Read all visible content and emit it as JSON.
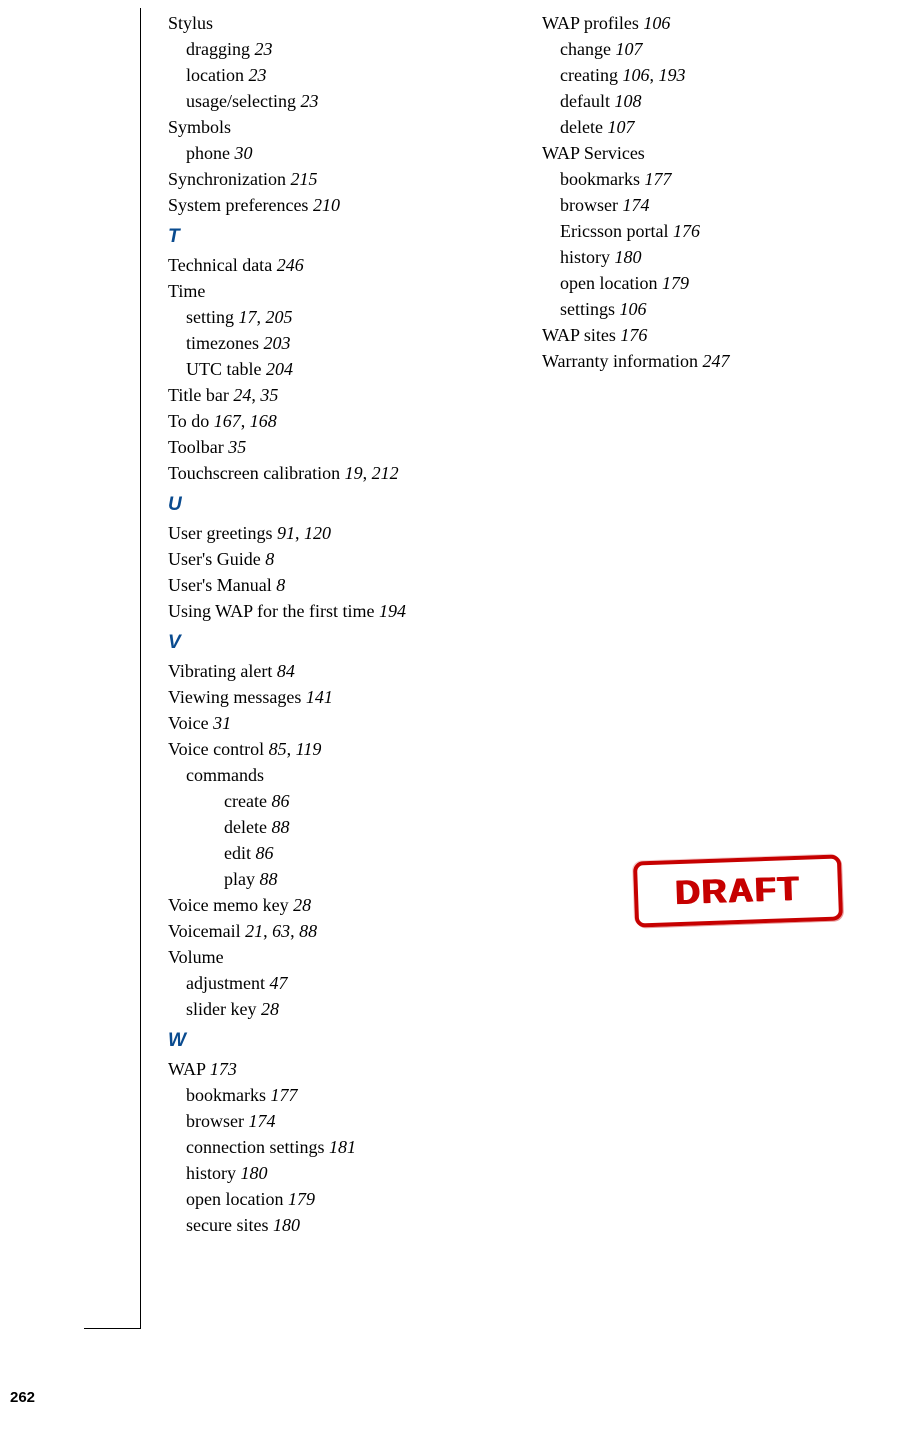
{
  "page_number": "262",
  "draft_label": "DRAFT",
  "columns": [
    {
      "items": [
        {
          "type": "entry",
          "level": 0,
          "text": "Stylus",
          "pages": ""
        },
        {
          "type": "entry",
          "level": 1,
          "text": "dragging",
          "pages": "23"
        },
        {
          "type": "entry",
          "level": 1,
          "text": "location",
          "pages": "23"
        },
        {
          "type": "entry",
          "level": 1,
          "text": "usage/selecting",
          "pages": "23"
        },
        {
          "type": "entry",
          "level": 0,
          "text": "Symbols",
          "pages": ""
        },
        {
          "type": "entry",
          "level": 1,
          "text": "phone",
          "pages": "30"
        },
        {
          "type": "entry",
          "level": 0,
          "text": "Synchronization",
          "pages": "215"
        },
        {
          "type": "entry",
          "level": 0,
          "text": "System preferences",
          "pages": "210"
        },
        {
          "type": "section",
          "letter": "T"
        },
        {
          "type": "entry",
          "level": 0,
          "text": "Technical data",
          "pages": "246"
        },
        {
          "type": "entry",
          "level": 0,
          "text": "Time",
          "pages": ""
        },
        {
          "type": "entry",
          "level": 1,
          "text": "setting",
          "pages": "17, 205"
        },
        {
          "type": "entry",
          "level": 1,
          "text": "timezones",
          "pages": "203"
        },
        {
          "type": "entry",
          "level": 1,
          "text": "UTC table",
          "pages": "204"
        },
        {
          "type": "entry",
          "level": 0,
          "text": "Title bar",
          "pages": "24, 35"
        },
        {
          "type": "entry",
          "level": 0,
          "text": "To do",
          "pages": "167, 168"
        },
        {
          "type": "entry",
          "level": 0,
          "text": "Toolbar",
          "pages": "35"
        },
        {
          "type": "entry",
          "level": 0,
          "text": "Touchscreen calibration",
          "pages": "19, 212"
        },
        {
          "type": "section",
          "letter": "U"
        },
        {
          "type": "entry",
          "level": 0,
          "text": "User greetings",
          "pages": "91, 120"
        },
        {
          "type": "entry",
          "level": 0,
          "text": "User's Guide",
          "pages": "8"
        },
        {
          "type": "entry",
          "level": 0,
          "text": "User's Manual",
          "pages": "8"
        },
        {
          "type": "entry",
          "level": 0,
          "text": "Using WAP for the first time",
          "pages": "194"
        },
        {
          "type": "section",
          "letter": "V"
        },
        {
          "type": "entry",
          "level": 0,
          "text": "Vibrating alert",
          "pages": "84"
        },
        {
          "type": "entry",
          "level": 0,
          "text": "Viewing messages",
          "pages": "141"
        },
        {
          "type": "entry",
          "level": 0,
          "text": "Voice",
          "pages": "31"
        },
        {
          "type": "entry",
          "level": 0,
          "text": "Voice control",
          "pages": "85, 119"
        },
        {
          "type": "entry",
          "level": 1,
          "text": "commands",
          "pages": ""
        },
        {
          "type": "entry",
          "level": 2,
          "text": "create",
          "pages": "86"
        },
        {
          "type": "entry",
          "level": 2,
          "text": "delete",
          "pages": "88"
        },
        {
          "type": "entry",
          "level": 2,
          "text": "edit",
          "pages": "86"
        },
        {
          "type": "entry",
          "level": 2,
          "text": "play",
          "pages": "88"
        },
        {
          "type": "entry",
          "level": 0,
          "text": "Voice memo key",
          "pages": "28"
        },
        {
          "type": "entry",
          "level": 0,
          "text": "Voicemail",
          "pages": "21, 63, 88"
        },
        {
          "type": "entry",
          "level": 0,
          "text": "Volume",
          "pages": ""
        },
        {
          "type": "entry",
          "level": 1,
          "text": "adjustment",
          "pages": "47"
        },
        {
          "type": "entry",
          "level": 1,
          "text": "slider key",
          "pages": "28"
        },
        {
          "type": "section",
          "letter": "W"
        },
        {
          "type": "entry",
          "level": 0,
          "text": "WAP",
          "pages": "173"
        },
        {
          "type": "entry",
          "level": 1,
          "text": "bookmarks",
          "pages": "177"
        },
        {
          "type": "entry",
          "level": 1,
          "text": "browser",
          "pages": "174"
        },
        {
          "type": "entry",
          "level": 1,
          "text": "connection settings",
          "pages": "181"
        },
        {
          "type": "entry",
          "level": 1,
          "text": "history",
          "pages": "180"
        },
        {
          "type": "entry",
          "level": 1,
          "text": "open location",
          "pages": "179"
        },
        {
          "type": "entry",
          "level": 1,
          "text": "secure sites",
          "pages": "180"
        }
      ]
    },
    {
      "items": [
        {
          "type": "entry",
          "level": 0,
          "text": "WAP profiles",
          "pages": "106"
        },
        {
          "type": "entry",
          "level": 1,
          "text": "change",
          "pages": "107"
        },
        {
          "type": "entry",
          "level": 1,
          "text": "creating",
          "pages": "106, 193"
        },
        {
          "type": "entry",
          "level": 1,
          "text": "default",
          "pages": "108"
        },
        {
          "type": "entry",
          "level": 1,
          "text": "delete",
          "pages": "107"
        },
        {
          "type": "entry",
          "level": 0,
          "text": "WAP Services",
          "pages": ""
        },
        {
          "type": "entry",
          "level": 1,
          "text": "bookmarks",
          "pages": "177"
        },
        {
          "type": "entry",
          "level": 1,
          "text": "browser",
          "pages": "174"
        },
        {
          "type": "entry",
          "level": 1,
          "text": "Ericsson portal",
          "pages": "176"
        },
        {
          "type": "entry",
          "level": 1,
          "text": "history",
          "pages": "180"
        },
        {
          "type": "entry",
          "level": 1,
          "text": "open location",
          "pages": "179"
        },
        {
          "type": "entry",
          "level": 1,
          "text": "settings",
          "pages": "106"
        },
        {
          "type": "entry",
          "level": 0,
          "text": "WAP sites",
          "pages": "176"
        },
        {
          "type": "entry",
          "level": 0,
          "text": "Warranty information",
          "pages": "247"
        }
      ]
    }
  ]
}
